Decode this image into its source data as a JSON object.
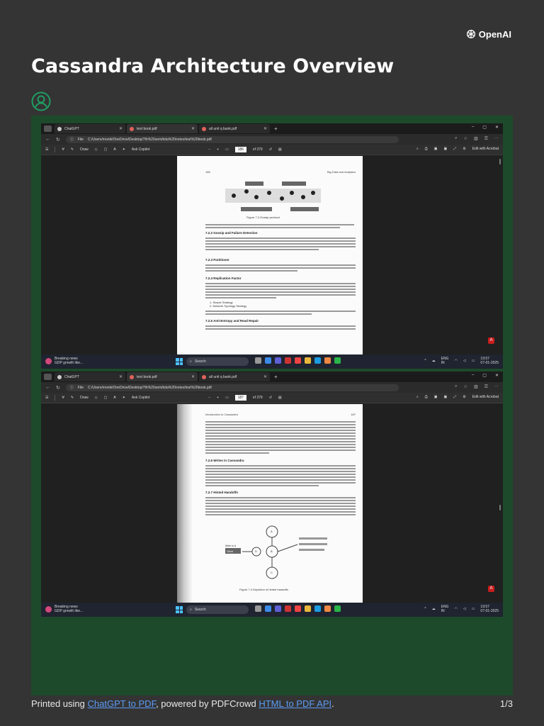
{
  "brand": {
    "name": "OpenAI"
  },
  "title": "Cassandra Architecture Overview",
  "screenshots": [
    {
      "tabs": [
        {
          "label": "ChatGPT",
          "icon": "chatgpt-icon"
        },
        {
          "label": "test book.pdf",
          "icon": "pdf-icon"
        },
        {
          "label": "all unit q bank.pdf",
          "icon": "pdf-icon"
        }
      ],
      "file_label": "File",
      "url": "C:/Users/monik/OneDrive/Desktop/7th%20sem/bda%20notes/test%20book.pdf",
      "toolbar": {
        "draw": "Draw",
        "ask": "Ask Copilot",
        "page": "186",
        "of": "of 379",
        "edit": "Edit with Acrobat"
      },
      "page_header_left": "186",
      "page_header_right": "Big Data and Analytics",
      "figure_caption": "Figure 7.3   Gossip protocol",
      "sections": [
        "7.2.2   Gossip and Failure Detection",
        "7.2.3   Partitioner",
        "7.2.4   Replication Factor",
        "7.2.5   Anti-Entropy and Read Repair"
      ],
      "list_items": [
        "1. Simple Strategy",
        "2. Network Topology Strategy"
      ],
      "taskbar": {
        "news_title": "Breaking news",
        "news_sub": "GDP growth like...",
        "search": "Search",
        "lang": "ENG",
        "region": "IN",
        "time": "19:57",
        "date": "07-01-2025"
      }
    },
    {
      "tabs": [
        {
          "label": "ChatGPT",
          "icon": "chatgpt-icon"
        },
        {
          "label": "test book.pdf",
          "icon": "pdf-icon"
        },
        {
          "label": "all unit q bank.pdf",
          "icon": "pdf-icon"
        }
      ],
      "file_label": "File",
      "url": "C:/Users/monik/OneDrive/Desktop/7th%20sem/bda%20notes/test%20book.pdf",
      "toolbar": {
        "draw": "Draw",
        "ask": "Ask Copilot",
        "page": "187",
        "of": "of 379",
        "edit": "Edit with Acrobat"
      },
      "page_header_left": "Introduction to Cassandra",
      "page_header_right": "187",
      "figure_caption": "Figure 7.4   Depiction of hinted handoffs.",
      "sections": [
        "7.2.6   Writes in Cassandra",
        "7.2.7   Hinted Handoffs"
      ],
      "diagram_labels": {
        "client": "Client",
        "write_to_a": "Write to A",
        "node_a": "A",
        "node_b": "B",
        "node_c": "C",
        "node_d": "D"
      },
      "taskbar": {
        "news_title": "Breaking news",
        "news_sub": "GDP growth like...",
        "search": "Search",
        "lang": "ENG",
        "region": "IN",
        "time": "19:57",
        "date": "07-01-2025"
      }
    }
  ],
  "footer": {
    "prefix": "Printed using ",
    "link1": "ChatGPT to PDF",
    "middle": ", powered by PDFCrowd ",
    "link2": "HTML to PDF API",
    "suffix": ".",
    "page": "1/3"
  },
  "colors": {
    "background": "#343434",
    "panel": "#1d4a2b",
    "link": "#5b9bf5",
    "accent_green": "#1e9e62"
  }
}
